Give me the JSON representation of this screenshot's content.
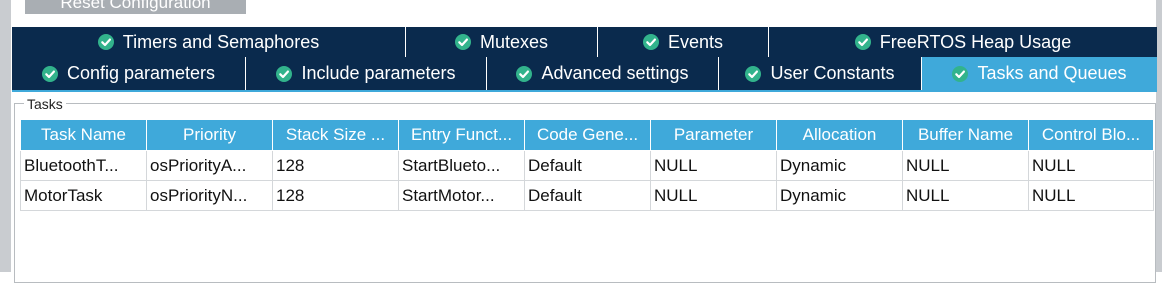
{
  "reset_button": {
    "label": "Reset Configuration"
  },
  "tabs_row1": [
    {
      "label": "Timers and Semaphores"
    },
    {
      "label": "Mutexes"
    },
    {
      "label": "Events"
    },
    {
      "label": "FreeRTOS Heap Usage"
    }
  ],
  "tabs_row2": [
    {
      "label": "Config parameters"
    },
    {
      "label": "Include parameters"
    },
    {
      "label": "Advanced settings"
    },
    {
      "label": "User Constants"
    },
    {
      "label": "Tasks and Queues",
      "active": true
    }
  ],
  "tasks_group": {
    "title": "Tasks"
  },
  "table": {
    "headers": [
      "Task Name",
      "Priority",
      "Stack Size ...",
      "Entry Funct...",
      "Code Gene...",
      "Parameter",
      "Allocation",
      "Buffer Name",
      "Control Blo..."
    ],
    "rows": [
      [
        "BluetoothT...",
        "osPriorityA...",
        "128",
        "StartBlueto...",
        "Default",
        "NULL",
        "Dynamic",
        "NULL",
        "NULL"
      ],
      [
        "MotorTask",
        "osPriorityN...",
        "128",
        "StartMotor...",
        "Default",
        "NULL",
        "Dynamic",
        "NULL",
        "NULL"
      ]
    ]
  },
  "colors": {
    "tab_bg": "#0a2a4d",
    "tab_active_bg": "#3fa9da",
    "check_icon": "#32b38c",
    "header_bg": "#3fa9da"
  },
  "icons": {
    "tab_status": "check-circle-icon"
  }
}
